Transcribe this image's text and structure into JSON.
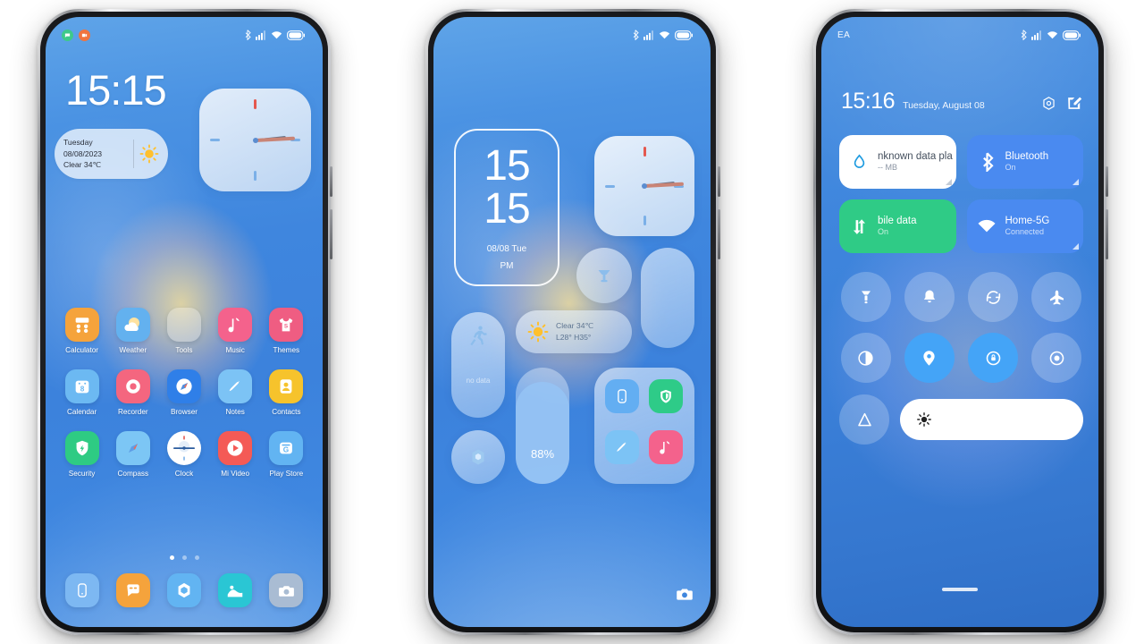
{
  "scene": {
    "background": "#ffffff",
    "phone_count": 3,
    "theme_accent": "#3f86de"
  },
  "phone1": {
    "name": "home-screen",
    "statusbar": {
      "notif_icons": [
        "message-notification-icon",
        "video-notification-icon"
      ],
      "icons": [
        "bluetooth-icon",
        "signal-icon",
        "wifi-icon",
        "battery-icon"
      ]
    },
    "clock": "15:15",
    "weather_widget": {
      "day": "Tuesday",
      "date": "08/08/2023",
      "condition": "Clear 34℃",
      "icon": "sun-icon"
    },
    "analog_widget": {
      "name": "analog-clock-widget",
      "hour": 3,
      "minute": 15
    },
    "app_rows": [
      [
        {
          "label": "Calculator",
          "icon": "calculator-icon",
          "color": "#f5a33c"
        },
        {
          "label": "Weather",
          "icon": "weather-icon",
          "color": "#63b1ef"
        },
        {
          "label": "Tools",
          "icon": "folder-icon",
          "color": "folder"
        },
        {
          "label": "Music",
          "icon": "music-note-icon",
          "color": "#f4628c"
        },
        {
          "label": "Themes",
          "icon": "tshirt-icon",
          "color": "#ef5d82"
        }
      ],
      [
        {
          "label": "Calendar",
          "icon": "calendar-icon",
          "color": "#6cb9f2"
        },
        {
          "label": "Recorder",
          "icon": "record-icon",
          "color": "#f4667f"
        },
        {
          "label": "Browser",
          "icon": "compass-icon",
          "color": "#2f7fe8"
        },
        {
          "label": "Notes",
          "icon": "note-icon",
          "color": "#7cc3f5"
        },
        {
          "label": "Contacts",
          "icon": "contacts-icon",
          "color": "#f6c32c"
        }
      ],
      [
        {
          "label": "Security",
          "icon": "shield-icon",
          "color": "#2ecb83"
        },
        {
          "label": "Compass",
          "icon": "compass-icon",
          "color": "#7cc6f5"
        },
        {
          "label": "Clock",
          "icon": "clock-icon",
          "color": "#ffffff"
        },
        {
          "label": "Mi Video",
          "icon": "play-icon",
          "color": "#f45a56"
        },
        {
          "label": "Play Store",
          "icon": "play-store-icon",
          "color": "#62b4f2"
        }
      ]
    ],
    "page_dots": {
      "count": 3,
      "active": 0
    },
    "dock": [
      {
        "icon": "phone-icon",
        "color": "#7db8f2"
      },
      {
        "icon": "messages-icon",
        "color": "#f5a33c"
      },
      {
        "icon": "settings-icon",
        "color": "#62b4f2"
      },
      {
        "icon": "gallery-icon",
        "color": "#2ac6d4"
      },
      {
        "icon": "camera-icon",
        "color": "#a9bcd3"
      }
    ]
  },
  "phone2": {
    "name": "widget-screen",
    "statusbar": {
      "icons": [
        "bluetooth-icon",
        "signal-icon",
        "wifi-icon",
        "battery-icon"
      ]
    },
    "clock_widget": {
      "hours": "15",
      "minutes": "15",
      "date": "08/08 Tue",
      "ampm": "PM"
    },
    "analog_widget": {
      "name": "analog-clock-widget",
      "hour": 3,
      "minute": 15
    },
    "bulb_widget": {
      "icon": "lamp-icon"
    },
    "empty_pill_widget": {
      "label": ""
    },
    "fitness_widget": {
      "icon": "running-icon",
      "status": "no data"
    },
    "weather_widget": {
      "icon": "sun-icon",
      "condition": "Clear 34℃",
      "range": "L28° H35°"
    },
    "gear_widget": {
      "icon": "settings-icon"
    },
    "battery_widget": {
      "percent": "88%",
      "fill": 88
    },
    "app_group": [
      {
        "icon": "phone-icon",
        "color": "#63aef2"
      },
      {
        "icon": "shield-icon",
        "color": "#2ecb88"
      },
      {
        "icon": "note-icon",
        "color": "#7cc3f5"
      },
      {
        "icon": "music-note-icon",
        "color": "#f4628c"
      }
    ],
    "camera_shortcut": {
      "icon": "camera-icon"
    }
  },
  "phone3": {
    "name": "control-center",
    "statusbar": {
      "carrier": "EA",
      "icons": [
        "bluetooth-icon",
        "signal-icon",
        "wifi-icon",
        "battery-icon"
      ]
    },
    "header": {
      "time": "15:16",
      "date": "Tuesday, August 08",
      "settings_icon": "settings-icon",
      "edit_icon": "edit-icon"
    },
    "tiles": [
      {
        "title": "nknown data pla",
        "sub": "-- MB",
        "icon": "data-drop-icon",
        "style": "white",
        "expandable": true
      },
      {
        "title": "Bluetooth",
        "sub": "On",
        "icon": "bluetooth-icon",
        "style": "blue",
        "expandable": true
      },
      {
        "title": "bile data",
        "sub": "On",
        "icon": "data-transfer-icon",
        "style": "green",
        "expandable": false
      },
      {
        "title": "Home-5G",
        "sub": "Connected",
        "icon": "wifi-icon",
        "style": "blue",
        "expandable": true
      }
    ],
    "toggles": [
      {
        "icon": "flashlight-icon",
        "on": false
      },
      {
        "icon": "bell-icon",
        "on": false
      },
      {
        "icon": "sync-icon",
        "on": false
      },
      {
        "icon": "airplane-icon",
        "on": false
      },
      {
        "icon": "dark-mode-icon",
        "on": false
      },
      {
        "icon": "location-icon",
        "on": true
      },
      {
        "icon": "rotation-lock-icon",
        "on": true
      },
      {
        "icon": "screen-record-icon",
        "on": false
      },
      {
        "icon": "auto-brightness-icon",
        "on": false
      }
    ],
    "brightness": {
      "icon": "brightness-sun-icon",
      "value": 0
    }
  }
}
